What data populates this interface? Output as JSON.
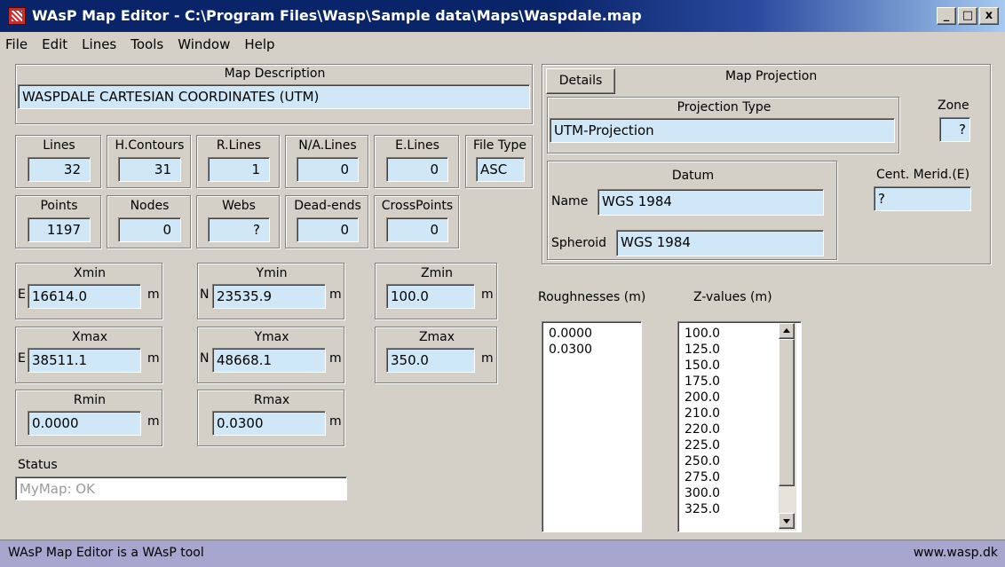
{
  "window": {
    "title": "WAsP Map Editor - C:\\Program Files\\Wasp\\Sample data\\Maps\\Waspdale.map",
    "minimize_label": "_",
    "maximize_label": "□",
    "close_label": "x"
  },
  "menu": [
    "File",
    "Edit",
    "Lines",
    "Tools",
    "Window",
    "Help"
  ],
  "map_description": {
    "label": "Map Description",
    "value": "WASPDALE  CARTESIAN COORDINATES (UTM)"
  },
  "stats_row1": [
    {
      "label": "Lines",
      "value": "32"
    },
    {
      "label": "H.Contours",
      "value": "31"
    },
    {
      "label": "R.Lines",
      "value": "1"
    },
    {
      "label": "N/A.Lines",
      "value": "0"
    },
    {
      "label": "E.Lines",
      "value": "0"
    }
  ],
  "file_type": {
    "label": "File Type",
    "value": "ASC"
  },
  "stats_row2": [
    {
      "label": "Points",
      "value": "1197"
    },
    {
      "label": "Nodes",
      "value": "0"
    },
    {
      "label": "Webs",
      "value": "?"
    },
    {
      "label": "Dead-ends",
      "value": "0"
    },
    {
      "label": "CrossPoints",
      "value": "0"
    }
  ],
  "extents": {
    "xmin": {
      "label": "Xmin",
      "prefix": "E",
      "value": "16614.0",
      "unit": "m"
    },
    "ymin": {
      "label": "Ymin",
      "prefix": "N",
      "value": "23535.9",
      "unit": "m"
    },
    "zmin": {
      "label": "Zmin",
      "value": "100.0",
      "unit": "m"
    },
    "xmax": {
      "label": "Xmax",
      "prefix": "E",
      "value": "38511.1",
      "unit": "m"
    },
    "ymax": {
      "label": "Ymax",
      "prefix": "N",
      "value": "48668.1",
      "unit": "m"
    },
    "zmax": {
      "label": "Zmax",
      "value": "350.0",
      "unit": "m"
    },
    "rmin": {
      "label": "Rmin",
      "value": "0.0000",
      "unit": "m"
    },
    "rmax": {
      "label": "Rmax",
      "value": "0.0300",
      "unit": "m"
    }
  },
  "status": {
    "label": "Status",
    "value": "MyMap: OK"
  },
  "projection": {
    "details_button": "Details",
    "label": "Map Projection",
    "type_label": "Projection Type",
    "type_value": "UTM-Projection",
    "zone_label": "Zone",
    "zone_value": "?",
    "datum_label": "Datum",
    "name_label": "Name",
    "name_value": "WGS 1984",
    "spheroid_label": "Spheroid",
    "spheroid_value": "WGS 1984",
    "cent_merid_label": "Cent. Merid.(E)",
    "cent_merid_value": "?"
  },
  "roughnesses": {
    "label": "Roughnesses (m)",
    "items": [
      "0.0000",
      "0.0300"
    ]
  },
  "zvalues": {
    "label": "Z-values (m)",
    "items": [
      "100.0",
      "125.0",
      "150.0",
      "175.0",
      "200.0",
      "210.0",
      "220.0",
      "225.0",
      "250.0",
      "275.0",
      "300.0",
      "325.0"
    ]
  },
  "statusbar": {
    "left": "WAsP Map Editor is a WAsP tool",
    "right": "www.wasp.dk"
  },
  "colors": {
    "field_bg": "#cfe7f7",
    "titlebar": "#0a246a",
    "statusbar": "#a7a6cf",
    "window_bg": "#d4d0c8"
  }
}
